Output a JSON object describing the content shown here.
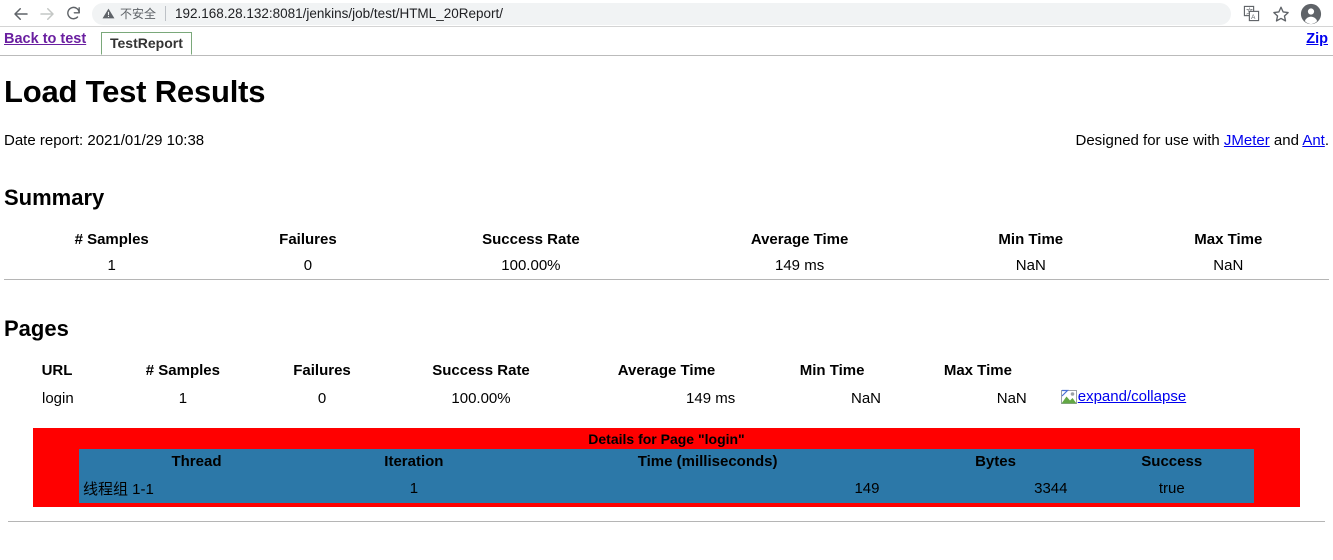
{
  "browser": {
    "back_icon": "arrow-left-icon",
    "forward_icon": "arrow-right-icon",
    "reload_icon": "reload-icon",
    "security_icon": "warning-triangle-icon",
    "security_label": "不安全",
    "url": "192.168.28.132:8081/jenkins/job/test/HTML_20Report/",
    "url_host": "192.168.28.132:8081",
    "url_path": "/jenkins/job/test/HTML_20Report/",
    "translate_icon": "translate-icon",
    "bookmark_icon": "star-icon",
    "profile_icon": "account-avatar-icon"
  },
  "report_header": {
    "back_label": "Back to test",
    "tab_label": "TestReport",
    "zip_label": "Zip",
    "link_color": "#6a1fa0",
    "tab_border_color": "#7aa87a",
    "zip_color": "#0000ee"
  },
  "page": {
    "title": "Load Test Results",
    "date_report": "Date report: 2021/01/29 10:38",
    "designed_prefix": "Designed for use with ",
    "designed_link1": "JMeter",
    "designed_middle": " and ",
    "designed_link2": "Ant",
    "designed_suffix": "."
  },
  "summary": {
    "title": "Summary",
    "columns": [
      "# Samples",
      "Failures",
      "Success Rate",
      "Average Time",
      "Min Time",
      "Max Time"
    ],
    "rows": [
      {
        "samples": "1",
        "failures": "0",
        "success_rate": "100.00%",
        "average_time": "149 ms",
        "min_time": "NaN",
        "max_time": "NaN"
      }
    ]
  },
  "pages": {
    "title": "Pages",
    "columns": [
      "URL",
      "# Samples",
      "Failures",
      "Success Rate",
      "Average Time",
      "Min Time",
      "Max Time",
      ""
    ],
    "rows": [
      {
        "url": "login",
        "samples": "1",
        "failures": "0",
        "success_rate": "100.00%",
        "average_time": "149 ms",
        "min_time": "NaN",
        "max_time": "NaN",
        "expand_label": "expand/collapse",
        "expand_icon": "broken-image-icon"
      }
    ]
  },
  "details": {
    "caption": "Details for Page \"login\"",
    "background_color": "#ff0000",
    "table_color": "#2c78a8",
    "columns": [
      "Thread",
      "Iteration",
      "Time (milliseconds)",
      "Bytes",
      "Success"
    ],
    "rows": [
      {
        "thread": "线程组 1-1",
        "iteration": "1",
        "time": "149",
        "bytes": "3344",
        "success": "true"
      }
    ]
  }
}
